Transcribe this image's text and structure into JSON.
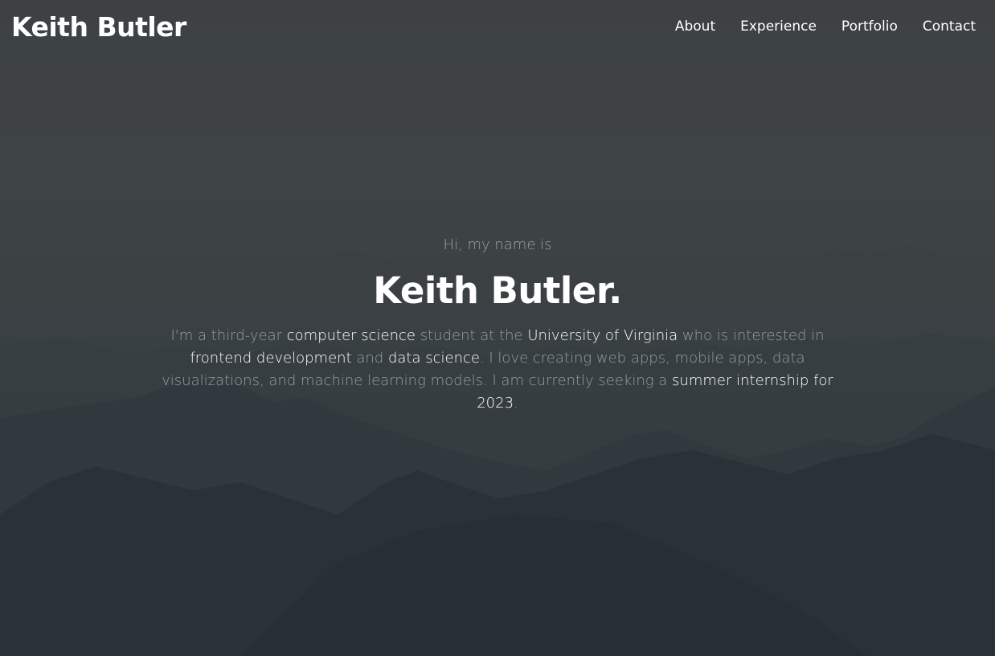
{
  "header": {
    "logo": "Keith Butler",
    "nav": [
      {
        "label": "About"
      },
      {
        "label": "Experience"
      },
      {
        "label": "Portfolio"
      },
      {
        "label": "Contact"
      }
    ]
  },
  "hero": {
    "greeting": "Hi, my name is",
    "name": "Keith Butler.",
    "bio": [
      {
        "text": "I'm a third-year ",
        "highlight": false
      },
      {
        "text": "computer science",
        "highlight": true
      },
      {
        "text": " student at the ",
        "highlight": false
      },
      {
        "text": "University of Virginia",
        "highlight": true
      },
      {
        "text": " who is interested in ",
        "highlight": false
      },
      {
        "text": "frontend development",
        "highlight": true
      },
      {
        "text": " and ",
        "highlight": false
      },
      {
        "text": "data science",
        "highlight": true
      },
      {
        "text": ". I love creating web apps, mobile apps, data visualizations, and machine learning models. I am currently seeking a ",
        "highlight": false
      },
      {
        "text": "summer internship for 2023",
        "highlight": true
      },
      {
        "text": ".",
        "highlight": false
      }
    ]
  },
  "colors": {
    "text_primary": "#ffffff",
    "text_muted": "#959da1",
    "background": "#3d4143"
  }
}
